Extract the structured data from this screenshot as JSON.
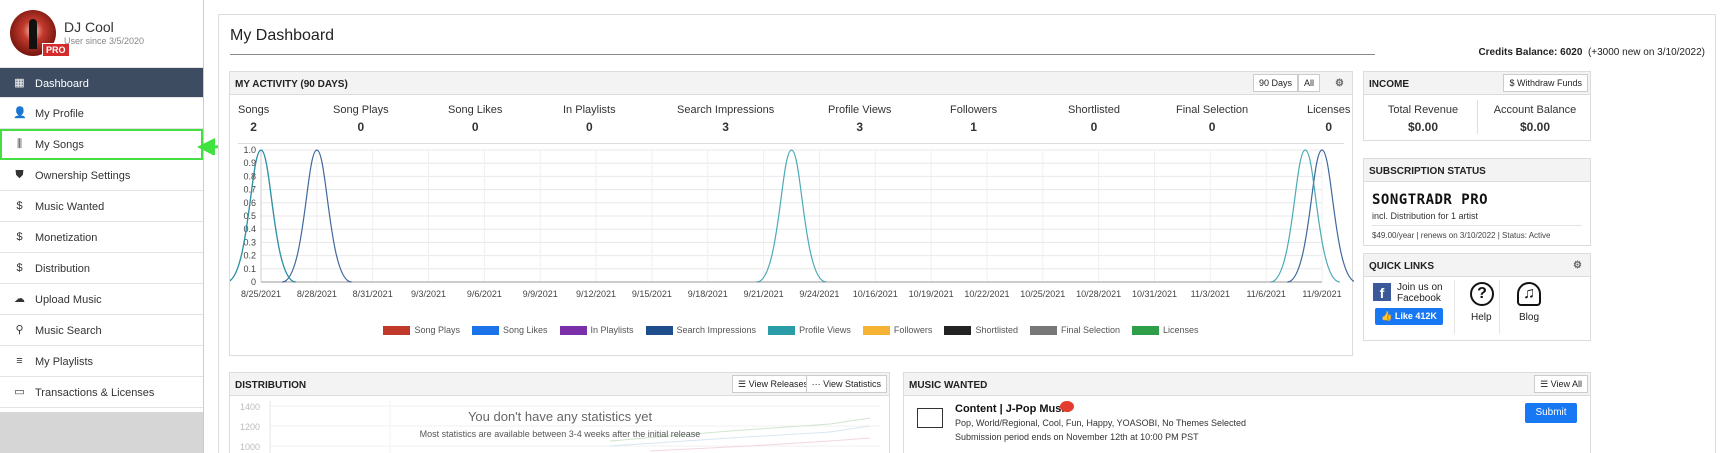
{
  "user": {
    "name": "DJ Cool",
    "since": "User since 3/5/2020",
    "badge": "PRO"
  },
  "sidebar": {
    "items": [
      {
        "label": "Dashboard",
        "icon": "grid-icon",
        "glyph": "▦"
      },
      {
        "label": "My Profile",
        "icon": "user-icon",
        "glyph": "👤"
      },
      {
        "label": "My Songs",
        "icon": "waveform-icon",
        "glyph": "⫼"
      },
      {
        "label": "Ownership Settings",
        "icon": "shield-icon",
        "glyph": "⛊"
      },
      {
        "label": "Music Wanted",
        "icon": "dollar-icon",
        "glyph": "$"
      },
      {
        "label": "Monetization",
        "icon": "dollar-icon",
        "glyph": "$"
      },
      {
        "label": "Distribution",
        "icon": "dollar-icon",
        "glyph": "$"
      },
      {
        "label": "Upload Music",
        "icon": "cloud-upload-icon",
        "glyph": "☁"
      },
      {
        "label": "Music Search",
        "icon": "search-icon",
        "glyph": "⚲"
      },
      {
        "label": "My Playlists",
        "icon": "playlist-icon",
        "glyph": "≡"
      },
      {
        "label": "Transactions & Licenses",
        "icon": "credit-card-icon",
        "glyph": "▭"
      }
    ]
  },
  "page": {
    "title": "My Dashboard",
    "credits_label": "Credits Balance:",
    "credits_value": "6020",
    "credits_note": "(+3000 new on 3/10/2022)"
  },
  "activity": {
    "title": "MY ACTIVITY (90 DAYS)",
    "btn_90": "90 Days",
    "btn_all": "All",
    "stats": [
      {
        "label": "Songs",
        "value": "2"
      },
      {
        "label": "Song Plays",
        "value": "0"
      },
      {
        "label": "Song Likes",
        "value": "0"
      },
      {
        "label": "In Playlists",
        "value": "0"
      },
      {
        "label": "Search Impressions",
        "value": "3"
      },
      {
        "label": "Profile Views",
        "value": "3"
      },
      {
        "label": "Followers",
        "value": "1"
      },
      {
        "label": "Shortlisted",
        "value": "0"
      },
      {
        "label": "Final Selection",
        "value": "0"
      },
      {
        "label": "Licenses",
        "value": "0"
      }
    ]
  },
  "chart_data": {
    "type": "line",
    "categories": [
      "8/25/2021",
      "8/28/2021",
      "8/31/2021",
      "9/3/2021",
      "9/6/2021",
      "9/9/2021",
      "9/12/2021",
      "9/15/2021",
      "9/18/2021",
      "9/21/2021",
      "9/24/2021",
      "10/16/2021",
      "10/19/2021",
      "10/22/2021",
      "10/25/2021",
      "10/28/2021",
      "10/31/2021",
      "11/3/2021",
      "11/6/2021",
      "11/9/2021"
    ],
    "y_ticks": [
      "0",
      "0.1",
      "0.2",
      "0.3",
      "0.4",
      "0.5",
      "0.6",
      "0.7",
      "0.8",
      "0.9",
      "1.0"
    ],
    "ylim": [
      0,
      1
    ],
    "grid": true,
    "legend_position": "bottom",
    "series": [
      {
        "name": "Song Plays",
        "color": "#c0392b",
        "spikes": []
      },
      {
        "name": "Song Likes",
        "color": "#1a73e8",
        "spikes": []
      },
      {
        "name": "In Playlists",
        "color": "#7b2fa8",
        "spikes": []
      },
      {
        "name": "Search Impressions",
        "color": "#1f4e8c",
        "spikes": [
          0.0,
          1.0,
          19.0,
          25.0
        ]
      },
      {
        "name": "Profile Views",
        "color": "#2a9ca8",
        "spikes": [
          0.0,
          9.5,
          18.7
        ]
      },
      {
        "name": "Followers",
        "color": "#f4b333",
        "spikes": []
      },
      {
        "name": "Shortlisted",
        "color": "#222222",
        "spikes": []
      },
      {
        "name": "Final Selection",
        "color": "#777777",
        "spikes": []
      },
      {
        "name": "Licenses",
        "color": "#2e9e48",
        "spikes": []
      }
    ]
  },
  "income": {
    "title": "INCOME",
    "withdraw": "Withdraw Funds",
    "total_label": "Total Revenue",
    "total_value": "$0.00",
    "balance_label": "Account Balance",
    "balance_value": "$0.00"
  },
  "subscription": {
    "title": "SUBSCRIPTION STATUS",
    "plan": "SONGTRADR PRO",
    "includes": "incl. Distribution for 1 artist",
    "details": "$49.00/year | renews on 3/10/2022 | Status: Active"
  },
  "quick_links": {
    "title": "QUICK LINKS",
    "join": "Join us on",
    "join2": "Facebook",
    "like": "Like 412K",
    "help": "Help",
    "blog": "Blog"
  },
  "distribution": {
    "title": "DISTRIBUTION",
    "view_releases": "View Releases",
    "view_stats": "View Statistics",
    "empty_title": "You don't have any statistics yet",
    "empty_sub": "Most statistics are available between 3-4 weeks after the initial release",
    "y_ticks": [
      "1400",
      "1200",
      "1000"
    ]
  },
  "music_wanted": {
    "title": "MUSIC WANTED",
    "view_all": "View All",
    "item_title": "Content | J-Pop Music",
    "genres": "Pop, World/Regional, Cool, Fun, Happy, YOASOBI, No Themes Selected",
    "period": "Submission period ends on November 12th at 10:00 PM PST",
    "submit": "Submit"
  }
}
